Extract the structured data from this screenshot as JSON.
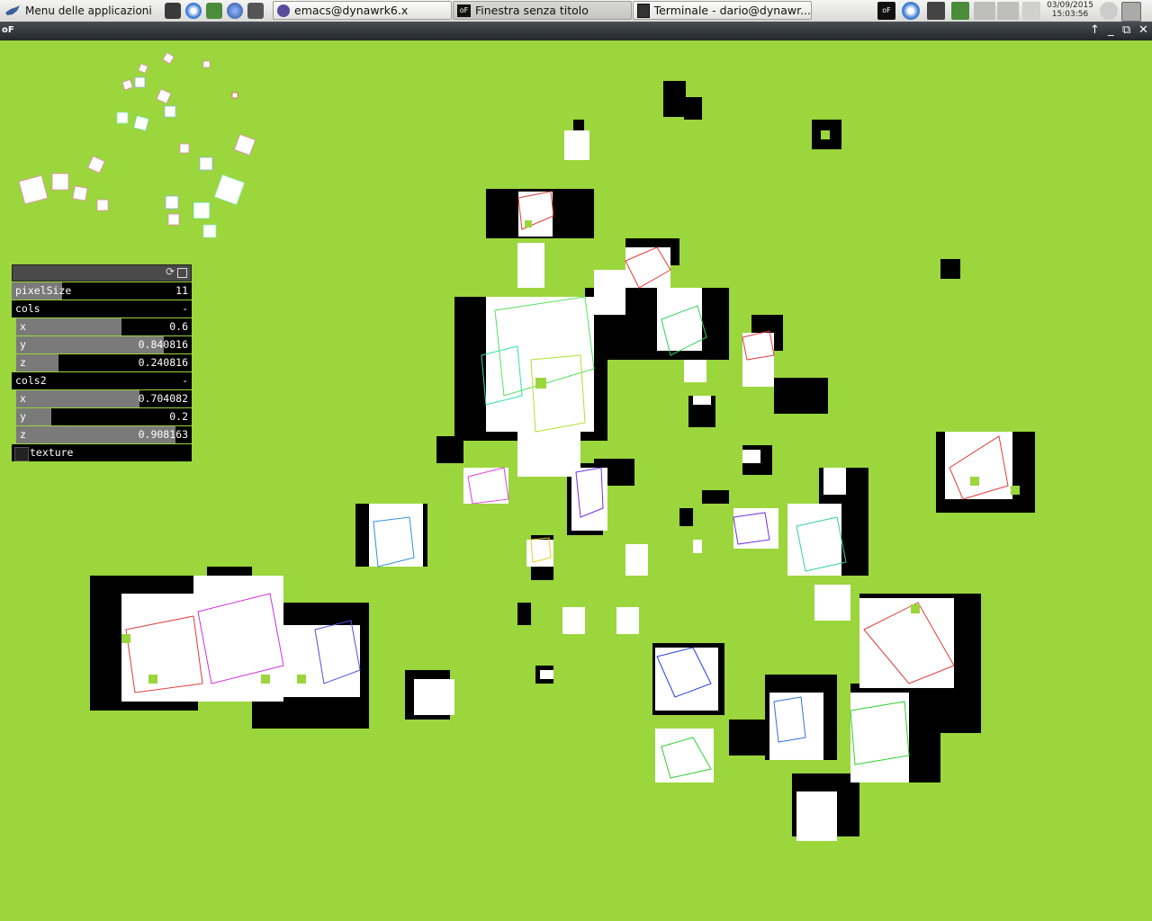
{
  "taskbar": {
    "menu_label": "Menu delle applicazioni",
    "tasks": [
      {
        "label": "emacs@dynawrk6.x"
      },
      {
        "label": "Finestra senza titolo"
      },
      {
        "label": "Terminale - dario@dynawr..."
      }
    ],
    "clock": {
      "date": "03/09/2015",
      "time": "15:03:56"
    }
  },
  "window": {
    "app_icon": "oF",
    "controls": [
      "maximize-arrow",
      "minimize",
      "restore",
      "close"
    ]
  },
  "gui": {
    "pixelSize": {
      "label": "pixelSize",
      "value": "11"
    },
    "cols": {
      "title": "cols",
      "toggle": "-",
      "x": {
        "label": "x",
        "value": "0.6",
        "fraction": 0.6
      },
      "y": {
        "label": "y",
        "value": "0.840816",
        "fraction": 0.840816
      },
      "z": {
        "label": "z",
        "value": "0.240816",
        "fraction": 0.240816
      }
    },
    "cols2": {
      "title": "cols2",
      "toggle": "-",
      "x": {
        "label": "x",
        "value": "0.704082",
        "fraction": 0.704082
      },
      "y": {
        "label": "y",
        "value": "0.2",
        "fraction": 0.2
      },
      "z": {
        "label": "z",
        "value": "0.908163",
        "fraction": 0.908163
      }
    },
    "texture": {
      "label": "texture",
      "checked": false
    }
  },
  "colors": {
    "background": "#9bd63c",
    "panel": "#000000",
    "slider_fill": "#7a7a7a"
  }
}
